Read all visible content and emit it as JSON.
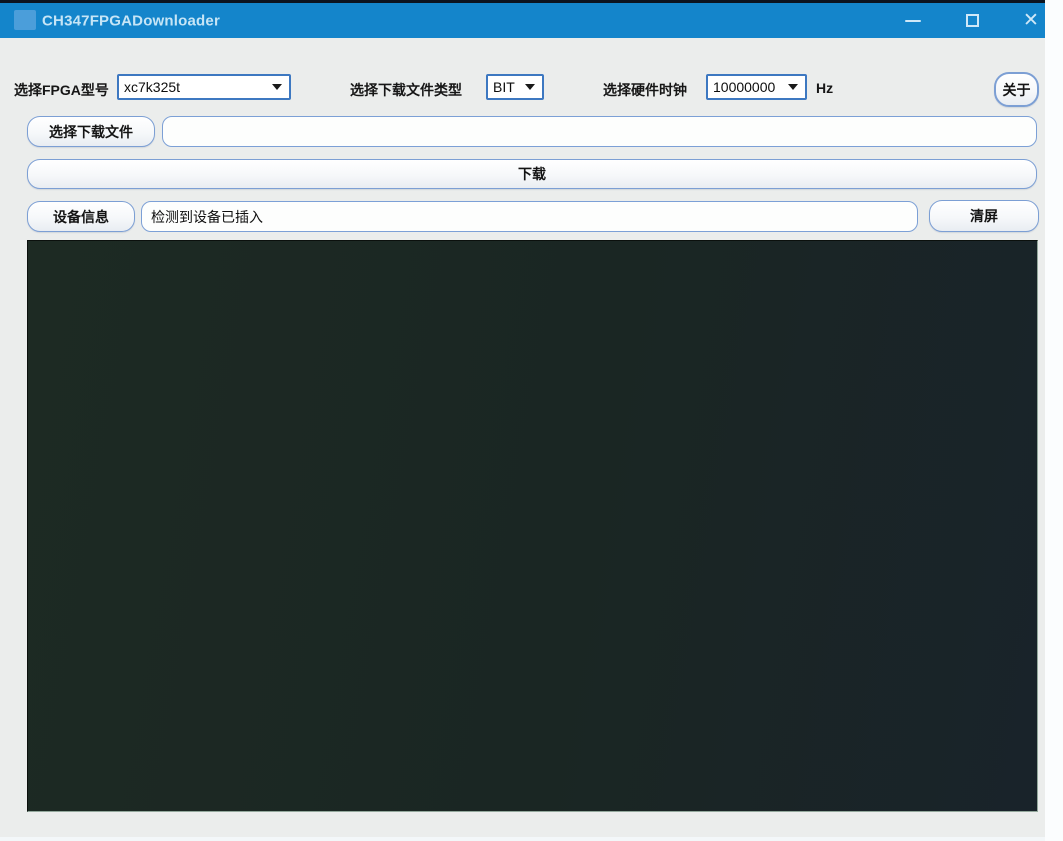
{
  "titlebar": {
    "title": "CH347FPGADownloader"
  },
  "toolbar": {
    "fpga_model_label": "选择FPGA型号",
    "fpga_model_value": "xc7k325t",
    "file_type_label": "选择下载文件类型",
    "file_type_value": "BIT",
    "clock_label": "选择硬件时钟",
    "clock_value": "10000000",
    "clock_unit": "Hz",
    "about_label": "关于"
  },
  "file_row": {
    "select_button_label": "选择下载文件",
    "path_value": ""
  },
  "download": {
    "label": "下载"
  },
  "device_row": {
    "info_button_label": "设备信息",
    "status_value": "检测到设备已插入",
    "clear_button_label": "清屏"
  },
  "console": {
    "text": ""
  },
  "colors": {
    "titlebar_blue": "#1485cb",
    "body_gray": "#ebedec",
    "console_bg": "#1b2723",
    "combo_border": "#3d78c1",
    "control_border": "#7c9fd4"
  }
}
